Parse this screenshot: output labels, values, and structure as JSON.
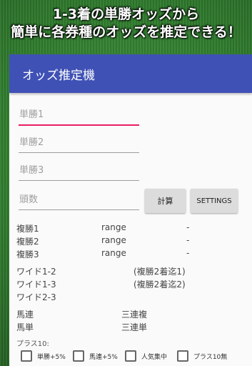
{
  "promo": {
    "line1": "1-3着の単勝オッズから",
    "line2": "簡単に各券種のオッズを推定できる！"
  },
  "app": {
    "title": "オッズ推定機"
  },
  "inputs": {
    "win1": {
      "placeholder": "単勝1"
    },
    "win2": {
      "placeholder": "単勝2"
    },
    "win3": {
      "placeholder": "単勝3"
    },
    "heads": {
      "placeholder": "頭数"
    }
  },
  "buttons": {
    "calc": "計算",
    "settings": "SETTINGS"
  },
  "place": [
    {
      "label": "複勝1",
      "range": "range",
      "value": "-"
    },
    {
      "label": "複勝2",
      "range": "range",
      "value": "-"
    },
    {
      "label": "複勝3",
      "range": "range",
      "value": "-"
    }
  ],
  "wide": [
    {
      "label": "ワイド1-2",
      "note": "(複勝2着迄1)"
    },
    {
      "label": "ワイド1-3",
      "note": "(複勝2着迄2)"
    },
    {
      "label": "ワイド2-3",
      "note": ""
    }
  ],
  "bets": {
    "quinella": "馬連",
    "trio": "三連複",
    "exacta": "馬単",
    "trifecta": "三連単"
  },
  "plus10": {
    "label": "プラス10:",
    "options": [
      {
        "label": "単勝+5%",
        "checked": false
      },
      {
        "label": "馬連+5%",
        "checked": false
      },
      {
        "label": "人気集中",
        "checked": false
      },
      {
        "label": "プラス10無",
        "checked": false
      }
    ]
  }
}
